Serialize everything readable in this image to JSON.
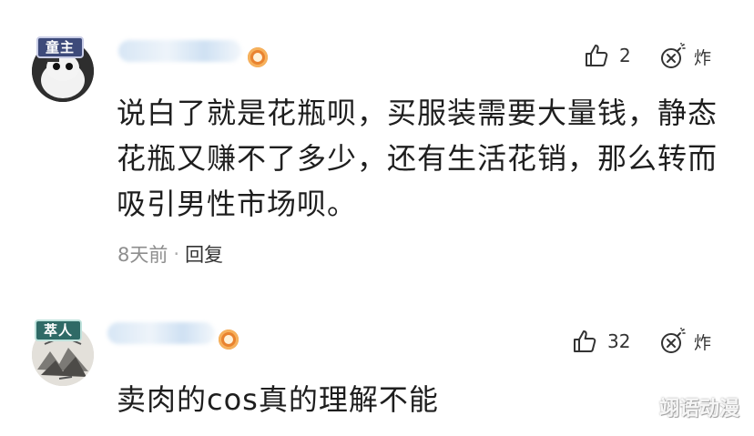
{
  "comments": [
    {
      "badge": "童主",
      "like_count": "2",
      "boom_label": "炸",
      "text": "说白了就是花瓶呗，买服装需要大量钱，静态花瓶又赚不了多少，还有生活花销，那么转而吸引男性市场呗。",
      "time": "8天前",
      "separator": "·",
      "reply_label": "回复"
    },
    {
      "badge": "萃人",
      "like_count": "32",
      "boom_label": "炸",
      "text": "卖肉的cos真的理解不能"
    }
  ],
  "watermark": "翊语动漫",
  "icons": {
    "like": "thumbs-up-icon",
    "boom": "bomb-icon",
    "level": "level-badge-icon"
  },
  "colors": {
    "level_icon": "#e9832f",
    "meta_text": "#8e8e8e"
  }
}
